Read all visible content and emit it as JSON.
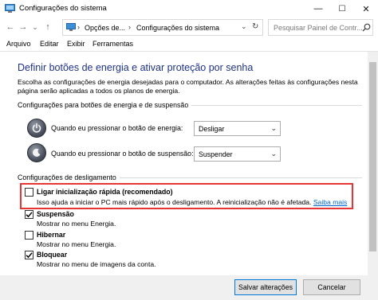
{
  "window": {
    "title": "Configurações do sistema",
    "controls": {
      "minimize": "—",
      "maximize": "☐",
      "close": "✕"
    }
  },
  "nav": {
    "back": "←",
    "forward": "→",
    "up": "↑",
    "recent": "⌄",
    "breadcrumb": [
      "Opções de...",
      "Configurações do sistema"
    ],
    "breadcrumb_sep": "›",
    "dropdown": "⌄",
    "refresh": "↻",
    "search_placeholder": "Pesquisar Painel de Contr..."
  },
  "menu": [
    "Arquivo",
    "Editar",
    "Exibir",
    "Ferramentas"
  ],
  "heading": "Definir botões de energia e ativar proteção por senha",
  "description": "Escolha as configurações de energia desejadas para o computador. As alterações feitas às configurações nesta página serão aplicadas a todos os planos de energia.",
  "power_group": {
    "label": "Configurações para botões de energia e de suspensão",
    "rows": [
      {
        "label": "Quando eu pressionar o botão de energia:",
        "value": "Desligar"
      },
      {
        "label": "Quando eu pressionar o botão de suspensão:",
        "value": "Suspender"
      }
    ]
  },
  "shutdown_group": {
    "label": "Configurações de desligamento",
    "options": [
      {
        "label": "Ligar inicialização rápida (recomendado)",
        "checked": false,
        "desc": "Isso ajuda a iniciar o PC mais rápido após o desligamento. A reinicialização não é afetada.",
        "link": "Saiba mais"
      },
      {
        "label": "Suspensão",
        "checked": true,
        "desc": "Mostrar no menu Energia."
      },
      {
        "label": "Hibernar",
        "checked": false,
        "desc": "Mostrar no menu Energia."
      },
      {
        "label": "Bloquear",
        "checked": true,
        "desc": "Mostrar no menu de imagens da conta."
      }
    ]
  },
  "footer": {
    "save": "Salvar alterações",
    "cancel": "Cancelar"
  },
  "colors": {
    "heading": "#1e3287",
    "highlight": "#e53535",
    "link": "#0066cc"
  }
}
